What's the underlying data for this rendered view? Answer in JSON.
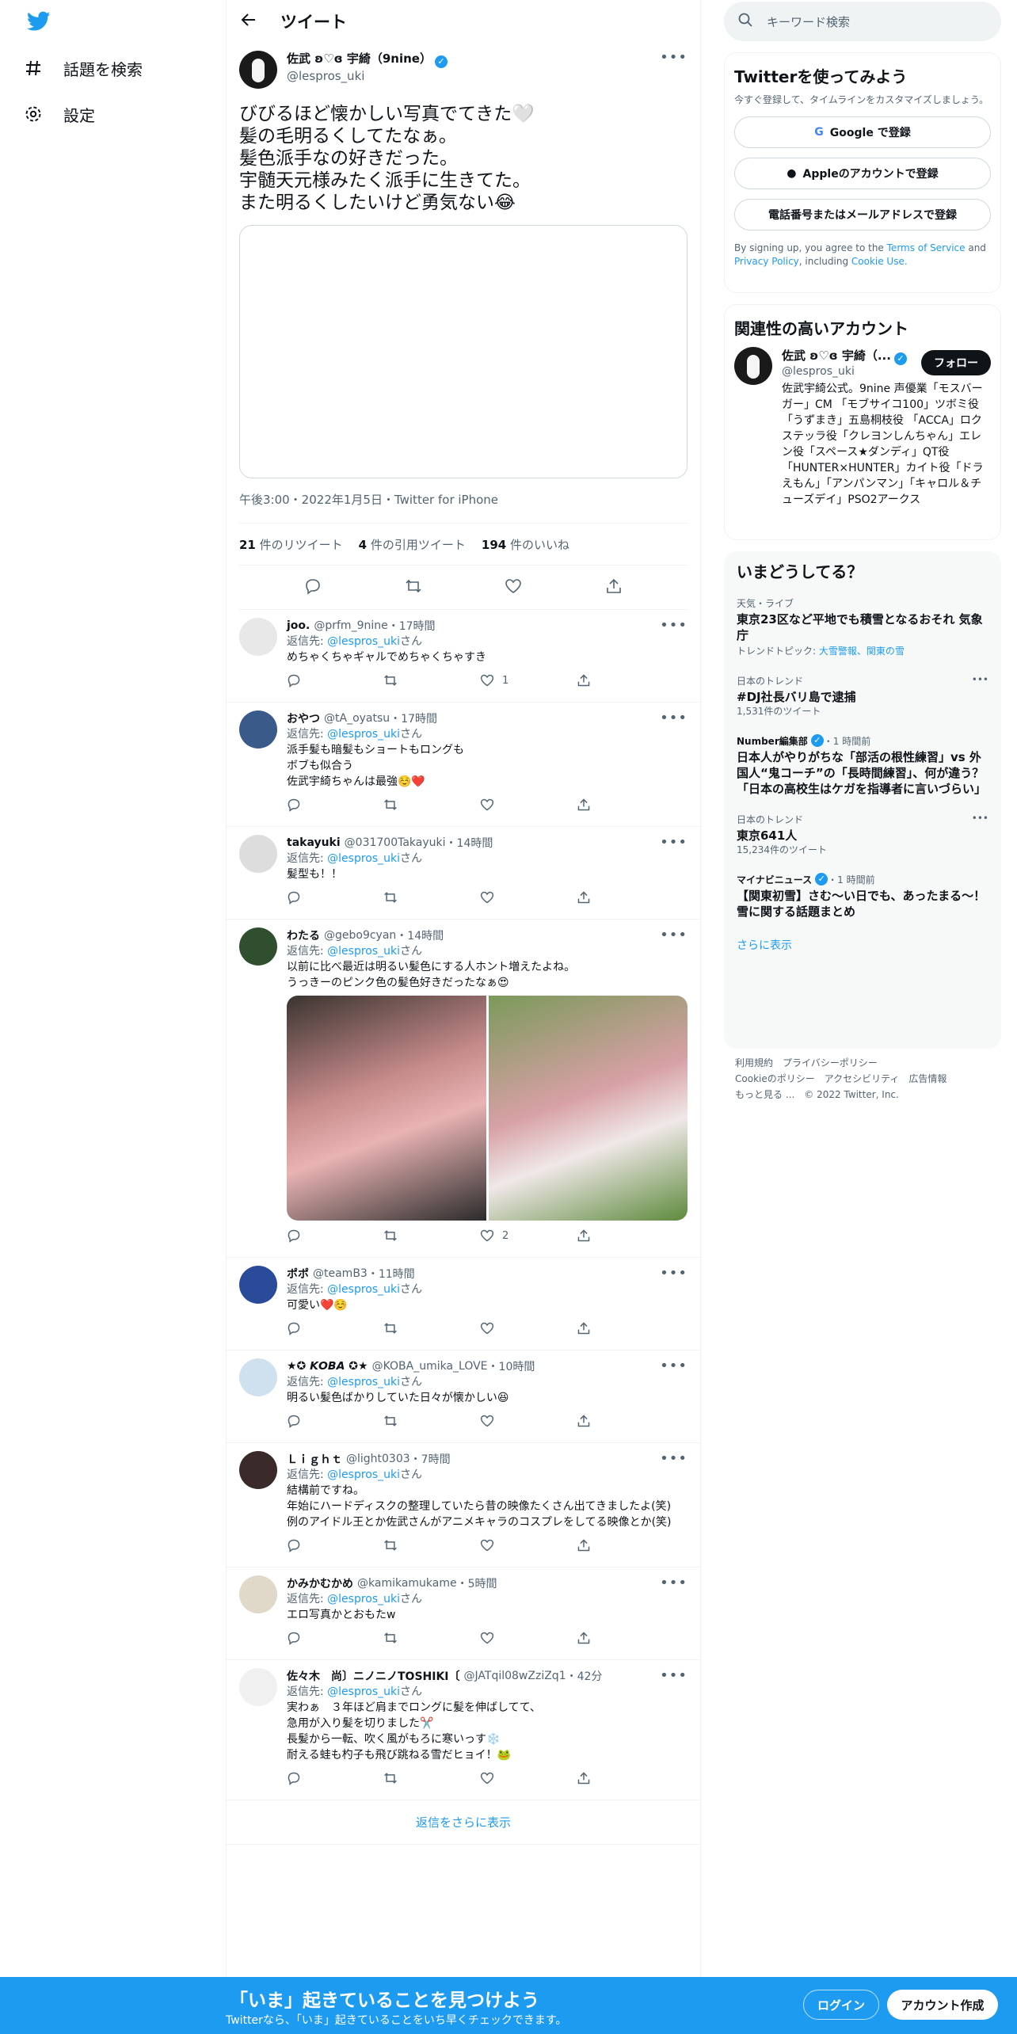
{
  "nav": {
    "search_label": "話題を検索",
    "settings_label": "設定"
  },
  "header": {
    "title": "ツイート"
  },
  "main_tweet": {
    "name": "佐武 ʚ♡ɞ 宇綺（9nine）",
    "handle": "@lespros_uki",
    "text": "びびるほど懐かしい写真でてきた🤍\n髪の毛明るくしてたなぁ。\n髪色派手なの好きだった。\n宇髄天元様みたく派手に生きてた。\nまた明るくしたいけど勇気ない😂",
    "timestamp": "午後3:00・2022年1月5日・Twitter for iPhone",
    "retweets": "21",
    "retweets_label": "件のリツイート",
    "quotes": "4",
    "quotes_label": "件の引用ツイート",
    "likes": "194",
    "likes_label": "件のいいね"
  },
  "replies": [
    {
      "name": "joo.",
      "handle": "@prfm_9nine",
      "time": "・17時間",
      "to_prefix": "返信先: ",
      "to": "@lespros_uki",
      "to_suffix": "さん",
      "text": "めちゃくちゃギャルでめちゃくちゃすき",
      "likes": "1"
    },
    {
      "name": "おやつ",
      "handle": "@tA_oyatsu",
      "time": "・17時間",
      "to_prefix": "返信先: ",
      "to": "@lespros_uki",
      "to_suffix": "さん",
      "text": "派手髪も暗髪もショートもロングも\nボブも似合う\n佐武宇綺ちゃんは最強☺️❤️",
      "likes": ""
    },
    {
      "name": "takayuki",
      "handle": "@031700Takayuki",
      "time": "・14時間",
      "to_prefix": "返信先: ",
      "to": "@lespros_uki",
      "to_suffix": "さん",
      "text": "髪型も！！",
      "likes": ""
    },
    {
      "name": "わたる",
      "handle": "@gebo9cyan",
      "time": "・14時間",
      "to_prefix": "返信先: ",
      "to": "@lespros_uki",
      "to_suffix": "さん",
      "text": "以前に比べ最近は明るい髪色にする人ホント増えたよね。\nうっきーのピンク色の髪色好きだったなぁ😍",
      "likes": "2"
    },
    {
      "name": "ポポ",
      "handle": "@teamB3",
      "time": "・11時間",
      "to_prefix": "返信先: ",
      "to": "@lespros_uki",
      "to_suffix": "さん",
      "text": "可愛い❤️☺️",
      "likes": ""
    },
    {
      "name": "★✪ 𝙆𝙊𝘽𝘼 ✪★",
      "handle": "@KOBA_umika_LOVE",
      "time": "・10時間",
      "to_prefix": "返信先: ",
      "to": "@lespros_uki",
      "to_suffix": "さん",
      "text": "明るい髪色ばかりしていた日々が懐かしい😆",
      "likes": ""
    },
    {
      "name": "Ｌｉｇｈｔ",
      "handle": "@light0303",
      "time": "・7時間",
      "to_prefix": "返信先: ",
      "to": "@lespros_uki",
      "to_suffix": "さん",
      "text": "結構前ですね。\n年始にハードディスクの整理していたら昔の映像たくさん出てきましたよ(笑)\n例のアイドル王とか佐武さんがアニメキャラのコスプレをしてる映像とか(笑)",
      "likes": ""
    },
    {
      "name": "かみかむかめ",
      "handle": "@kamikamukame",
      "time": "・5時間",
      "to_prefix": "返信先: ",
      "to": "@lespros_uki",
      "to_suffix": "さん",
      "text": "エロ写真かとおもたw",
      "likes": ""
    },
    {
      "name": "佐々木　尚〕ニノニノTOSHIKI〔",
      "handle": "@JATqil08wZziZq1",
      "time": "・42分",
      "to_prefix": "返信先: ",
      "to": "@lespros_uki",
      "to_suffix": "さん",
      "text": "実わぁ　３年ほど肩までロングに髪を伸ばしてて、\n急用が入り髪を切りました✂️\n長髪から一転、吹く風がもろに寒いっす❄️\n耐える蛙も杓子も飛び跳ねる雪だヒョイ！🐸",
      "likes": ""
    }
  ],
  "show_more_replies": "返信をさらに表示",
  "search": {
    "placeholder": "キーワード検索"
  },
  "signup": {
    "title": "Twitterを使ってみよう",
    "subtitle": "今すぐ登録して、タイムラインをカスタマイズしましょう。",
    "google": "Google で登録",
    "apple": "Appleのアカウントで登録",
    "phone": "電話番号またはメールアドレスで登録",
    "terms_pre": "By signing up, you agree to the ",
    "terms": "Terms of Service",
    "terms_and": " and ",
    "privacy": "Privacy Policy",
    "including": ", including ",
    "cookie": "Cookie Use."
  },
  "related": {
    "title": "関連性の高いアカウント",
    "name": "佐武 ʚ♡ɞ 宇綺（...",
    "handle": "@lespros_uki",
    "follow": "フォロー",
    "bio": "佐武宇綺公式。9nine 声優業「モスバーガー」CM 「モブサイコ100」ツボミ役 「うずまき」五島桐枝役 「ACCA」ロクステッラ役「クレヨンしんちゃん」エレン役「スペース★ダンディ」QT役 「HUNTER×HUNTER」カイト役「ドラえもん」「アンパンマン」「キャロル＆チューズデイ」PSO2アークス"
  },
  "trends": {
    "title": "いまどうしてる？",
    "items": [
      {
        "category": "天気・ライブ",
        "title": "東京23区など平地でも積雪となるおそれ 気象庁",
        "extra_prefix": "トレンドトピック: ",
        "extra_links": "大雪警報、関東の雪"
      },
      {
        "category": "日本のトレンド",
        "title": "#DJ社長バリ島で逮捕",
        "count": "1,531件のツイート"
      },
      {
        "source": "Number編集部",
        "time": "・1 時間前",
        "title": "日本人がやりがちな「部活の根性練習」vs 外国人“鬼コーチ”の「長時間練習」、何が違う？「日本の高校生はケガを指導者に言いづらい」"
      },
      {
        "category": "日本のトレンド",
        "title": "東京641人",
        "count": "15,234件のツイート"
      },
      {
        "source": "マイナビニュース",
        "time": "・1 時間前",
        "title": "【関東初雪】さむ～い日でも、あったまる～！雪に関する話題まとめ"
      }
    ],
    "show_more": "さらに表示"
  },
  "footer": {
    "links": [
      "利用規約",
      "プライバシーポリシー",
      "Cookieのポリシー",
      "アクセシビリティ",
      "広告情報",
      "もっと見る ..."
    ],
    "copyright": "© 2022 Twitter, Inc."
  },
  "bottom_bar": {
    "title": "「いま」起きていることを見つけよう",
    "subtitle": "Twitterなら、「いま」起きていることをいち早くチェックできます。",
    "login": "ログイン",
    "signup": "アカウント作成"
  },
  "colors": {
    "accent": "#1d9bf0",
    "text": "#0f1419",
    "muted": "#536471"
  }
}
